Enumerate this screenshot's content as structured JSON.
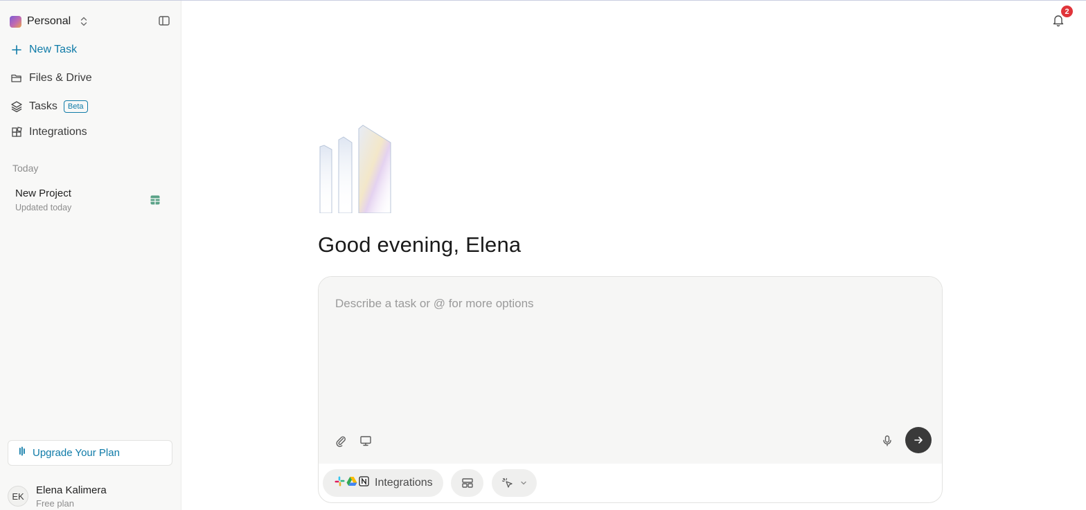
{
  "sidebar": {
    "workspace": {
      "name": "Personal",
      "logo_icon": "gradient-square"
    },
    "nav": {
      "new_task": "New Task",
      "files": "Files & Drive",
      "tasks": "Tasks",
      "tasks_badge": "Beta",
      "integrations": "Integrations"
    },
    "section_today": "Today",
    "project": {
      "title": "New Project",
      "subtitle": "Updated today"
    },
    "upgrade_label": "Upgrade Your Plan",
    "user": {
      "initials": "EK",
      "name": "Elena Kalimera",
      "plan": "Free plan"
    }
  },
  "header": {
    "notification_count": "2"
  },
  "main": {
    "greeting": "Good evening, Elena",
    "prompt_placeholder": "Describe a task or @ for more options",
    "integrations_chip": "Integrations",
    "integration_icons": [
      "slack-icon",
      "google-drive-icon",
      "notion-icon"
    ]
  },
  "colors": {
    "accent": "#0f7ba8",
    "badge": "#e0343a",
    "send_button": "#3a3a3a",
    "sidebar_bg": "#f8f8f7"
  }
}
